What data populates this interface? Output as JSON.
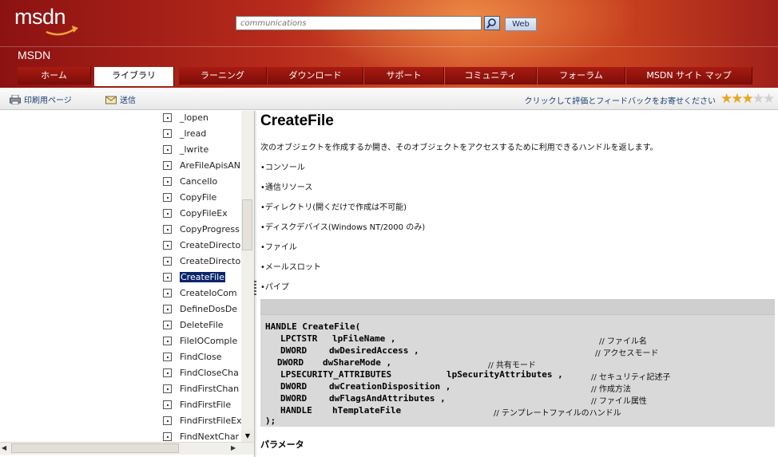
{
  "header": {
    "logo_text": "msdn",
    "brand": "MSDN",
    "search_placeholder": "communications",
    "web_button": "Web",
    "tabs": [
      "ホーム",
      "ライブラリ",
      "ラーニング",
      "ダウンロード",
      "サポート",
      "コミュニティ",
      "フォーラム",
      "MSDN サイト マップ"
    ],
    "active_tab": "ライブラリ"
  },
  "toolbar": {
    "print_label": "印刷用ページ",
    "send_label": "送信",
    "feedback_label": "クリックして評価とフィードバックをお寄せください",
    "rating": 3,
    "rating_max": 5
  },
  "nav": {
    "items": [
      "_lopen",
      "_lread",
      "_lwrite",
      "AreFileApisAN",
      "CancelIo",
      "CopyFile",
      "CopyFileEx",
      "CopyProgress",
      "CreateDirecto",
      "CreateDirecto",
      "CreateFile",
      "CreateIoCom",
      "DefineDosDe",
      "DeleteFile",
      "FileIOComple",
      "FindClose",
      "FindCloseCha",
      "FindFirstChan",
      "FindFirstFile",
      "FindFirstFileEx",
      "FindNextChar"
    ],
    "selected": "CreateFile"
  },
  "content": {
    "title": "CreateFile",
    "intro": "次のオブジェクトを作成するか開き、そのオブジェクトをアクセスするために利用できるハンドルを返します。",
    "bullets": [
      "•コンソール",
      "•通信リソース",
      "•ディレクトリ(開くだけで作成は不可能)",
      "•ディスクデバイス(Windows NT/2000 のみ)",
      "•ファイル",
      "•メールスロット",
      "•パイプ"
    ],
    "code": {
      "signature": "HANDLE CreateFile(",
      "close": ");",
      "params": [
        {
          "type": "LPCTSTR",
          "name": "lpFileName ,",
          "comment": "// ファイル名"
        },
        {
          "type": "DWORD",
          "name": "dwDesiredAccess ,",
          "comment": "// アクセスモード"
        },
        {
          "type": "DWORD",
          "name": "dwShareMode ,",
          "comment": "// 共有モード"
        },
        {
          "type": "LPSECURITY_ATTRIBUTES",
          "name": "lpSecurityAttributes ,",
          "comment": "// セキュリティ記述子"
        },
        {
          "type": "DWORD",
          "name": "dwCreationDisposition ,",
          "comment": "// 作成方法"
        },
        {
          "type": "DWORD",
          "name": "dwFlagsAndAttributes ,",
          "comment": "// ファイル属性"
        },
        {
          "type": "HANDLE",
          "name": "hTemplateFile",
          "comment": "// テンプレートファイルのハンドル"
        }
      ]
    },
    "params_heading": "パラメータ"
  }
}
